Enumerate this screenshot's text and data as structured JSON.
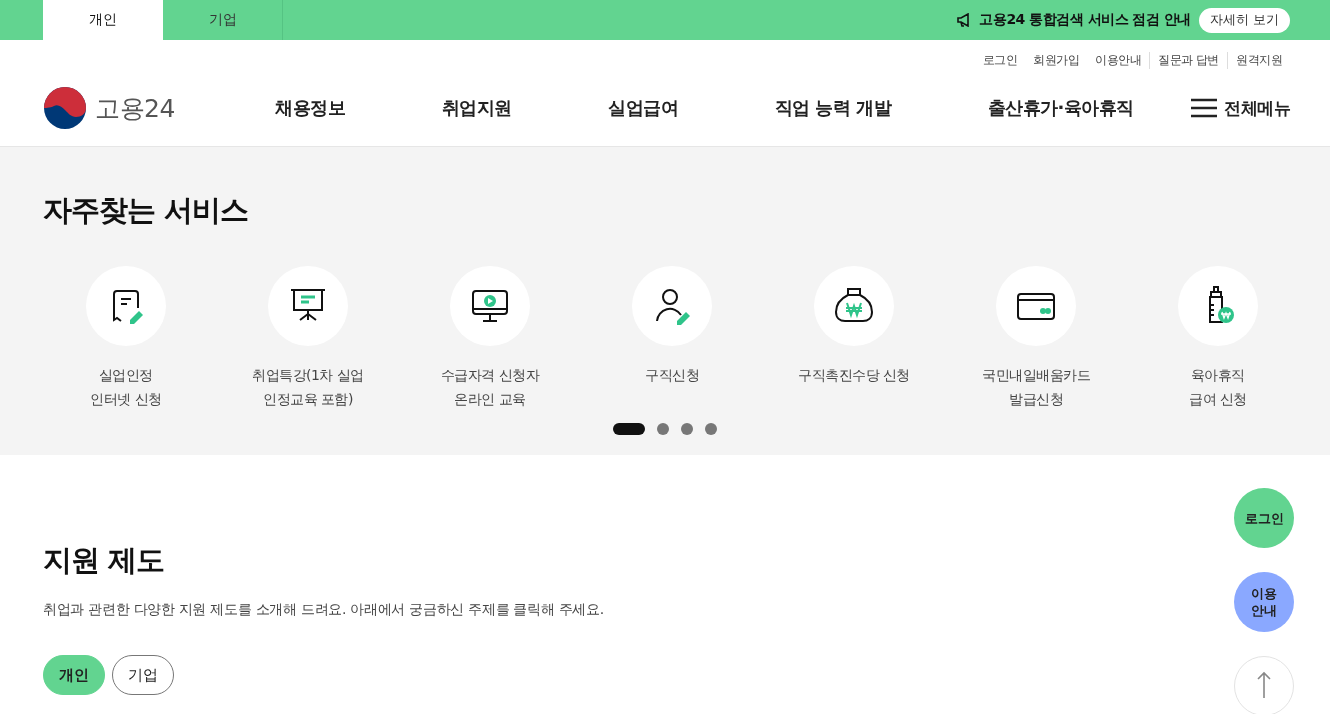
{
  "top_bar": {
    "tabs": [
      {
        "label": "개인",
        "selected": true
      },
      {
        "label": "기업",
        "selected": false
      }
    ],
    "notice": {
      "text": "고용24 통합검색 서비스 점검 안내",
      "button": "자세히 보기"
    }
  },
  "utility_links": [
    {
      "label": "로그인",
      "divider": false
    },
    {
      "label": "회원가입",
      "divider": false
    },
    {
      "label": "이용안내",
      "divider": false
    },
    {
      "label": "질문과 답변",
      "divider": true
    },
    {
      "label": "원격지원",
      "divider": true
    }
  ],
  "header": {
    "logo": "고용24",
    "nav": [
      "채용정보",
      "취업지원",
      "실업급여",
      "직업 능력 개발",
      "출산휴가·육아휴직"
    ],
    "all_menu": "전체메뉴"
  },
  "frequent_services": {
    "title": "자주찾는 서비스",
    "items": [
      {
        "label": "실업인정\n인터넷 신청"
      },
      {
        "label": "취업특강(1차 실업\n인정교육 포함)"
      },
      {
        "label": "수급자격 신청자\n온라인 교육"
      },
      {
        "label": "구직신청"
      },
      {
        "label": "구직촉진수당 신청"
      },
      {
        "label": "국민내일배움카드\n발급신청"
      },
      {
        "label": "육아휴직\n급여 신청"
      }
    ],
    "pager": [
      {
        "selected": true
      },
      {
        "selected": false
      },
      {
        "selected": false
      },
      {
        "selected": false
      }
    ]
  },
  "support": {
    "title": "지원 제도",
    "description": "취업과 관련한 다양한 지원 제도를 소개해 드려요. 아래에서 궁금하신 주제를 클릭해 주세요.",
    "tabs": [
      {
        "label": "개인",
        "selected": true
      },
      {
        "label": "기업",
        "selected": false
      }
    ]
  },
  "floating": {
    "login": "로그인",
    "guide": "이용\n안내"
  }
}
